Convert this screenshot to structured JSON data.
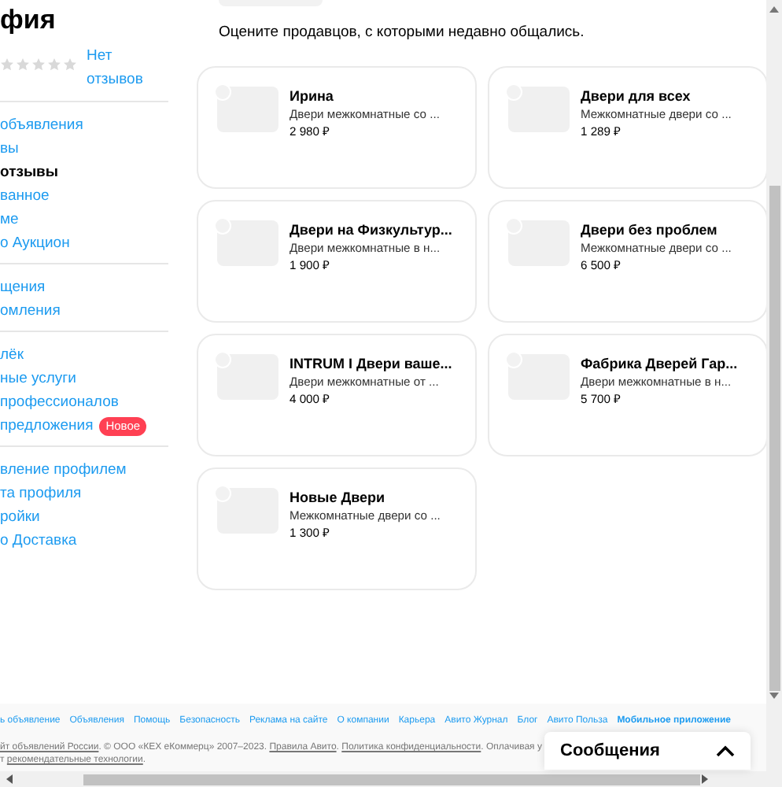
{
  "sidebar": {
    "title": "фия",
    "rating": {
      "stars": 0,
      "reviews_link": "Нет отзывов"
    },
    "groups": [
      [
        {
          "label": "объявления",
          "selected": false
        },
        {
          "label": "вы",
          "selected": false
        },
        {
          "label": "отзывы",
          "selected": true
        },
        {
          "label": "ванное",
          "selected": false
        },
        {
          "label": "ме",
          "selected": false
        },
        {
          "label": "о Аукцион",
          "selected": false
        }
      ],
      [
        {
          "label": "щения",
          "selected": false
        },
        {
          "label": "омления",
          "selected": false
        }
      ],
      [
        {
          "label": "лёк",
          "selected": false
        },
        {
          "label": "ные услуги",
          "selected": false
        },
        {
          "label": "профессионалов",
          "selected": false
        },
        {
          "label": "предложения",
          "selected": false,
          "badge": "Новое"
        }
      ],
      [
        {
          "label": "вление профилем",
          "selected": false
        },
        {
          "label": "та профиля",
          "selected": false
        },
        {
          "label": "ройки",
          "selected": false
        },
        {
          "label": "о Доставка",
          "selected": false
        }
      ]
    ]
  },
  "content": {
    "intro": "Оцените продавцов, с которыми недавно общались.",
    "sellers": [
      {
        "name": "Ирина",
        "description": "Двери межкомнатные со ...",
        "price": "2 980 ₽"
      },
      {
        "name": "Двери для всех",
        "description": "Межкомнатные двери со ...",
        "price": "1 289 ₽"
      },
      {
        "name": "Двери на Физкультур...",
        "description": "Двери межкомнатные в н...",
        "price": "1 900 ₽"
      },
      {
        "name": "Двери без проблем",
        "description": "Межкомнатные двери со ...",
        "price": "6 500 ₽"
      },
      {
        "name": "INTRUM I Двери ваше...",
        "description": "Двери межкомнатные от ...",
        "price": "4 000 ₽"
      },
      {
        "name": "Фабрика Дверей Гар...",
        "description": "Двери межкомнатные в н...",
        "price": "5 700 ₽"
      },
      {
        "name": "Новые Двери",
        "description": "Межкомнатные двери со ...",
        "price": "1 300 ₽"
      }
    ]
  },
  "footer": {
    "links": [
      {
        "label": "ь объявление",
        "bold": false
      },
      {
        "label": "Объявления",
        "bold": false
      },
      {
        "label": "Помощь",
        "bold": false
      },
      {
        "label": "Безопасность",
        "bold": false
      },
      {
        "label": "Реклама на сайте",
        "bold": false
      },
      {
        "label": "О компании",
        "bold": false
      },
      {
        "label": "Карьера",
        "bold": false
      },
      {
        "label": "Авито Журнал",
        "bold": false
      },
      {
        "label": "Блог",
        "bold": false
      },
      {
        "label": "Авито Польза",
        "bold": false
      },
      {
        "label": "Мобильное приложение",
        "bold": true
      }
    ],
    "legal": [
      [
        {
          "text": "йт объявлений России",
          "link": true
        },
        {
          "text": ". © ООО «КЕХ еКоммерц» 2007–2023. ",
          "link": false
        },
        {
          "text": "Правила Авито",
          "link": true
        },
        {
          "text": ". ",
          "link": false
        },
        {
          "text": "Политика конфиденциальности",
          "link": true
        },
        {
          "text": ". Оплачивая у",
          "link": false
        }
      ],
      [
        {
          "text": "т ",
          "link": false
        },
        {
          "text": "рекомендательные технологии",
          "link": true
        },
        {
          "text": ".",
          "link": false
        }
      ]
    ]
  },
  "messages_panel": {
    "title": "Сообщения"
  }
}
